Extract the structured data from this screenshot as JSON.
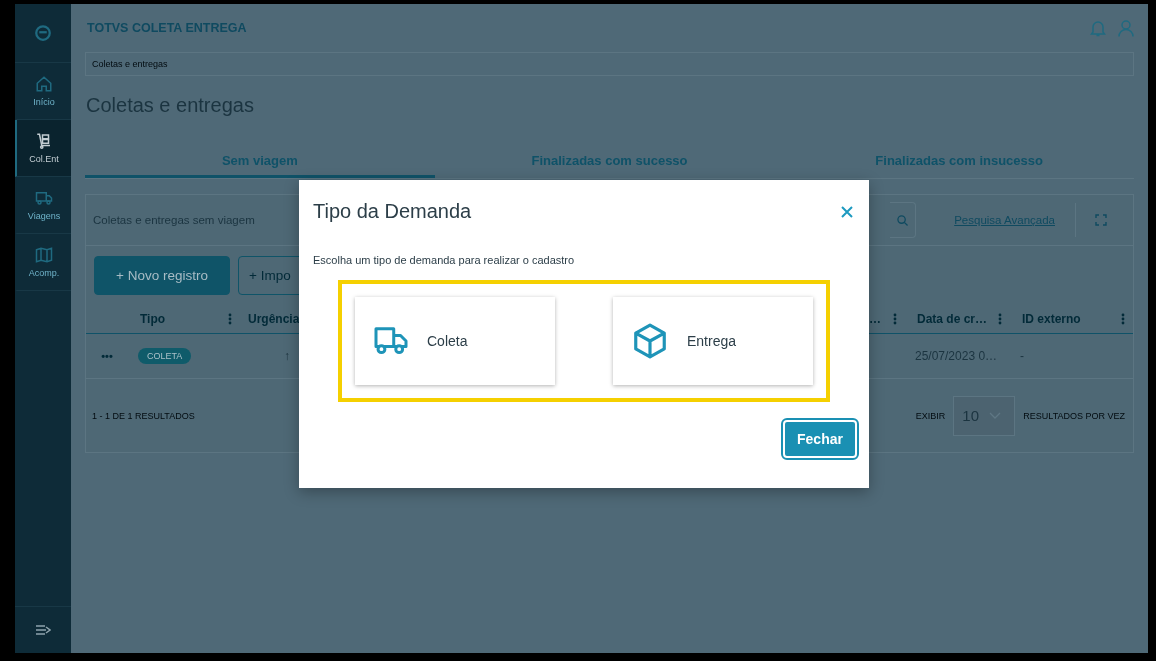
{
  "app": {
    "title": "TOTVS COLETA ENTREGA"
  },
  "sidebar": {
    "items": [
      {
        "label": "Início",
        "kind": "home",
        "selected": false
      },
      {
        "label": "Col.Ent",
        "kind": "dolly",
        "selected": true
      },
      {
        "label": "Viagens",
        "kind": "truck",
        "selected": false
      },
      {
        "label": "Acomp.",
        "kind": "map",
        "selected": false
      }
    ]
  },
  "breadcrumb": "Coletas e entregas",
  "page_title": "Coletas e entregas",
  "tabs": [
    {
      "label": "Sem viagem",
      "selected": true
    },
    {
      "label": "Finalizadas com sucesso",
      "selected": false
    },
    {
      "label": "Finalizadas com insucesso",
      "selected": false
    }
  ],
  "card": {
    "title": "Coletas e entregas sem viagem",
    "advanced_search_link": "Pesquisa Avançada"
  },
  "actions": [
    {
      "label": "+ Novo registro",
      "kind": "primary"
    },
    {
      "label": "+ Impo",
      "kind": "secondary"
    }
  ],
  "table": {
    "columns": [
      {
        "label": "Tipo"
      },
      {
        "label": "Urgência"
      },
      {
        "label": "…"
      },
      {
        "label": "Data de cr…"
      },
      {
        "label": "ID externo"
      }
    ],
    "rows": [
      {
        "menu": "•••",
        "tipo": "COLETA",
        "urgencia": "↑",
        "data": "25/07/2023 0…",
        "id_externo": "-"
      }
    ]
  },
  "footer": {
    "results": "1 - 1 DE 1 RESULTADOS",
    "show_label": "EXIBIR",
    "page_size": "10",
    "per_page_label": "RESULTADOS POR VEZ"
  },
  "modal": {
    "title": "Tipo da Demanda",
    "description": "Escolha um tipo de demanda para realizar o cadastro",
    "options": [
      {
        "label": "Coleta",
        "kind": "truck"
      },
      {
        "label": "Entrega",
        "kind": "box"
      }
    ],
    "close_button": "Fechar"
  }
}
